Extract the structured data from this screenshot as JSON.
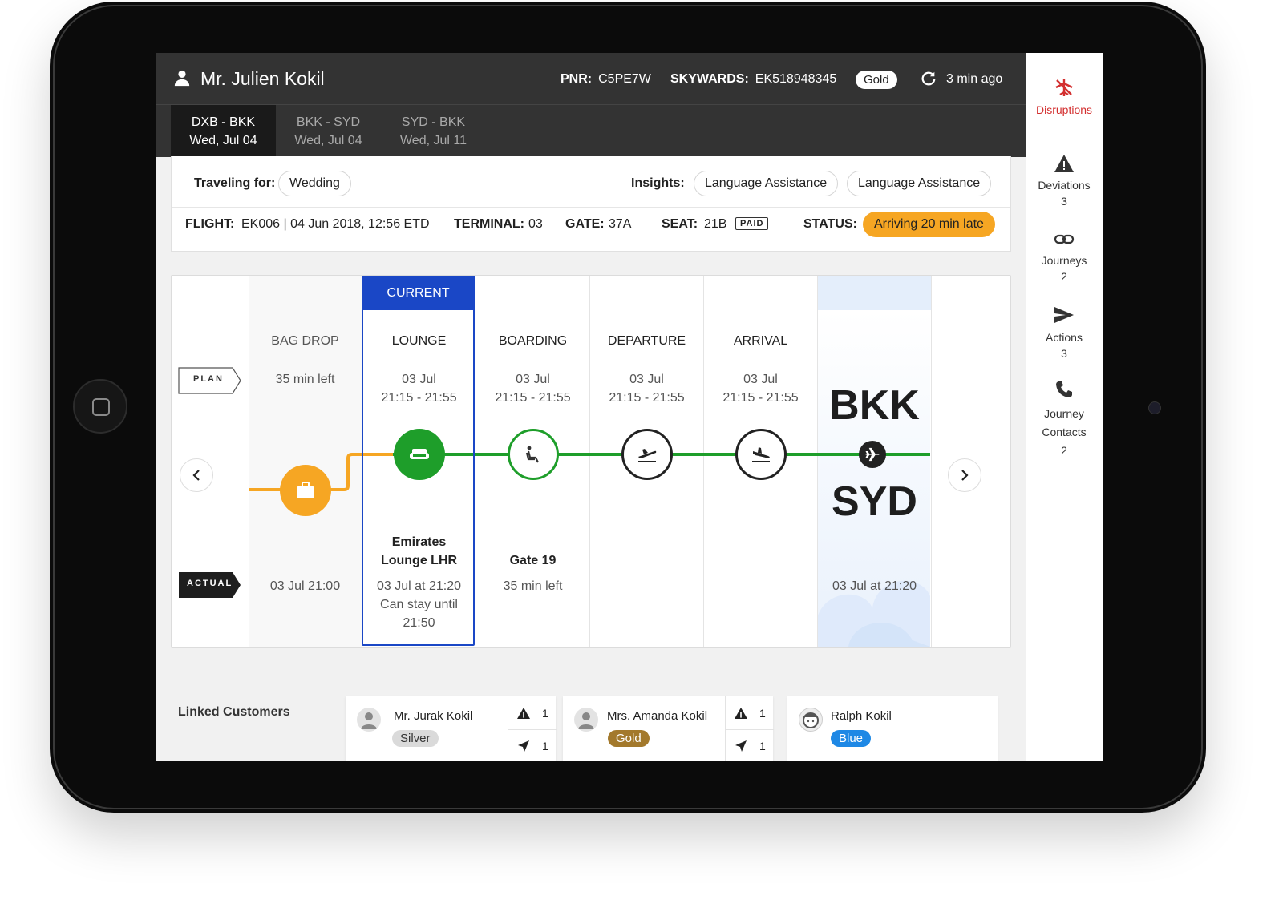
{
  "header": {
    "passenger_name": "Mr. Julien Kokil",
    "pnr_label": "PNR:",
    "pnr_value": "C5PE7W",
    "skywards_label": "SKYWARDS:",
    "skywards_value": "EK518948345",
    "tier": "Gold",
    "updated": "3 min ago"
  },
  "tabs": [
    {
      "route": "DXB - BKK",
      "date": "Wed, Jul 04"
    },
    {
      "route": "BKK - SYD",
      "date": "Wed, Jul 04"
    },
    {
      "route": "SYD - BKK",
      "date": "Wed, Jul 11"
    }
  ],
  "info": {
    "traveling_for_label": "Traveling for:",
    "traveling_for_value": "Wedding",
    "insights_label": "Insights:",
    "insights": [
      "Language Assistance",
      "Language Assistance"
    ],
    "flight_label": "FLIGHT:",
    "flight_value": "EK006 | 04 Jun 2018, 12:56 ETD",
    "terminal_label": "TERMINAL:",
    "terminal_value": "03",
    "gate_label": "GATE:",
    "gate_value": "37A",
    "seat_label": "SEAT:",
    "seat_value": "21B",
    "seat_badge": "PAID",
    "status_label": "STATUS:",
    "status_value": "Arriving 20 min late"
  },
  "timeline": {
    "plan_tag": "PLAN",
    "actual_tag": "ACTUAL",
    "current_label": "CURRENT",
    "stages": [
      {
        "title": "BAG DROP",
        "plan1": "35 min left",
        "plan2": "",
        "actual_bold1": "",
        "actual_bold2": "",
        "actual1": "03 Jul 21:00",
        "actual2": "",
        "actual3": ""
      },
      {
        "title": "LOUNGE",
        "plan1": "03 Jul",
        "plan2": "21:15 - 21:55",
        "actual_bold1": "Emirates",
        "actual_bold2": "Lounge LHR",
        "actual1": "03 Jul at 21:20",
        "actual2": "Can stay until",
        "actual3": "21:50"
      },
      {
        "title": "BOARDING",
        "plan1": "03 Jul",
        "plan2": "21:15 - 21:55",
        "actual_bold1": "",
        "actual_bold2": "Gate 19",
        "actual1": "35 min left",
        "actual2": "",
        "actual3": ""
      },
      {
        "title": "DEPARTURE",
        "plan1": "03 Jul",
        "plan2": "21:15 - 21:55",
        "actual_bold1": "",
        "actual_bold2": "",
        "actual1": "",
        "actual2": "",
        "actual3": ""
      },
      {
        "title": "ARRIVAL",
        "plan1": "03 Jul",
        "plan2": "21:15 - 21:55",
        "actual_bold1": "",
        "actual_bold2": "",
        "actual1": "",
        "actual2": "",
        "actual3": ""
      }
    ],
    "destination": {
      "from": "BKK",
      "to": "SYD",
      "actual": "03 Jul at 21:20"
    }
  },
  "sidebar": [
    {
      "label": "Disruptions",
      "count": ""
    },
    {
      "label": "Deviations",
      "count": "3"
    },
    {
      "label": "Journeys",
      "count": "2"
    },
    {
      "label": "Actions",
      "count": "3"
    },
    {
      "label": "Journey",
      "label2": "Contacts",
      "count": "2"
    }
  ],
  "linked": {
    "title": "Linked Customers",
    "customers": [
      {
        "name": "Mr. Jurak Kokil",
        "tier": "Silver",
        "alerts": "1",
        "actions": "1"
      },
      {
        "name": "Mrs. Amanda Kokil",
        "tier": "Gold",
        "alerts": "1",
        "actions": "1"
      },
      {
        "name": "Ralph Kokil",
        "tier": "Blue"
      }
    ]
  },
  "colors": {
    "accent_blue": "#1a47c6",
    "green": "#1e9e2a",
    "orange": "#f6a623",
    "disruption_red": "#d32f2f"
  }
}
